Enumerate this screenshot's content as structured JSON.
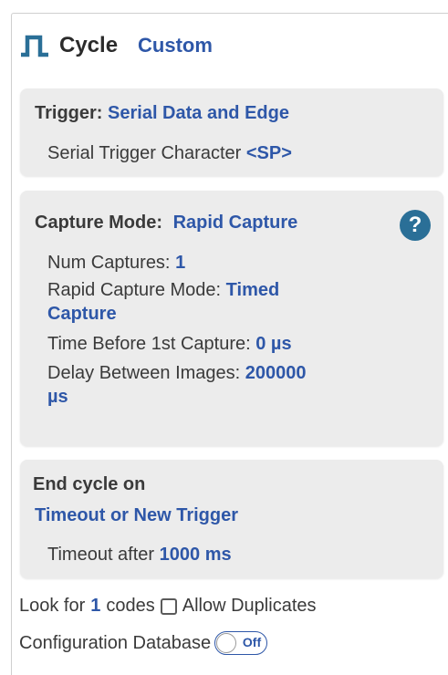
{
  "header": {
    "title": "Cycle",
    "mode": "Custom",
    "icon": "pulse-wave-icon"
  },
  "trigger": {
    "label": "Trigger:",
    "value": "Serial Data and Edge",
    "serial_label": "Serial Trigger Character",
    "serial_value": "<SP>"
  },
  "capture": {
    "label": "Capture Mode:",
    "value": "Rapid Capture",
    "help_glyph": "?",
    "num_captures_label": "Num Captures:",
    "num_captures_value": "1",
    "rapid_mode_label": "Rapid Capture Mode:",
    "rapid_mode_value_1": "Timed",
    "rapid_mode_value_2": "Capture",
    "time_before_label": "Time Before 1st Capture:",
    "time_before_value": "0 µs",
    "delay_label": "Delay Between Images:",
    "delay_value": "200000",
    "delay_unit": "µs"
  },
  "end_cycle": {
    "label": "End cycle on",
    "value": "Timeout or New Trigger",
    "timeout_label": "Timeout after",
    "timeout_value": "1000 ms"
  },
  "footer": {
    "look_for_label": "Look for",
    "look_for_value": "1",
    "codes_label": "codes",
    "allow_duplicates_label": "Allow Duplicates",
    "allow_duplicates_checked": false,
    "config_db_label": "Configuration Database",
    "config_db_toggle_text": "Off"
  },
  "colors": {
    "accent": "#2e57a8",
    "card_bg": "#ececec",
    "help_bg": "#2a6f97",
    "text": "#3a3a3a"
  }
}
